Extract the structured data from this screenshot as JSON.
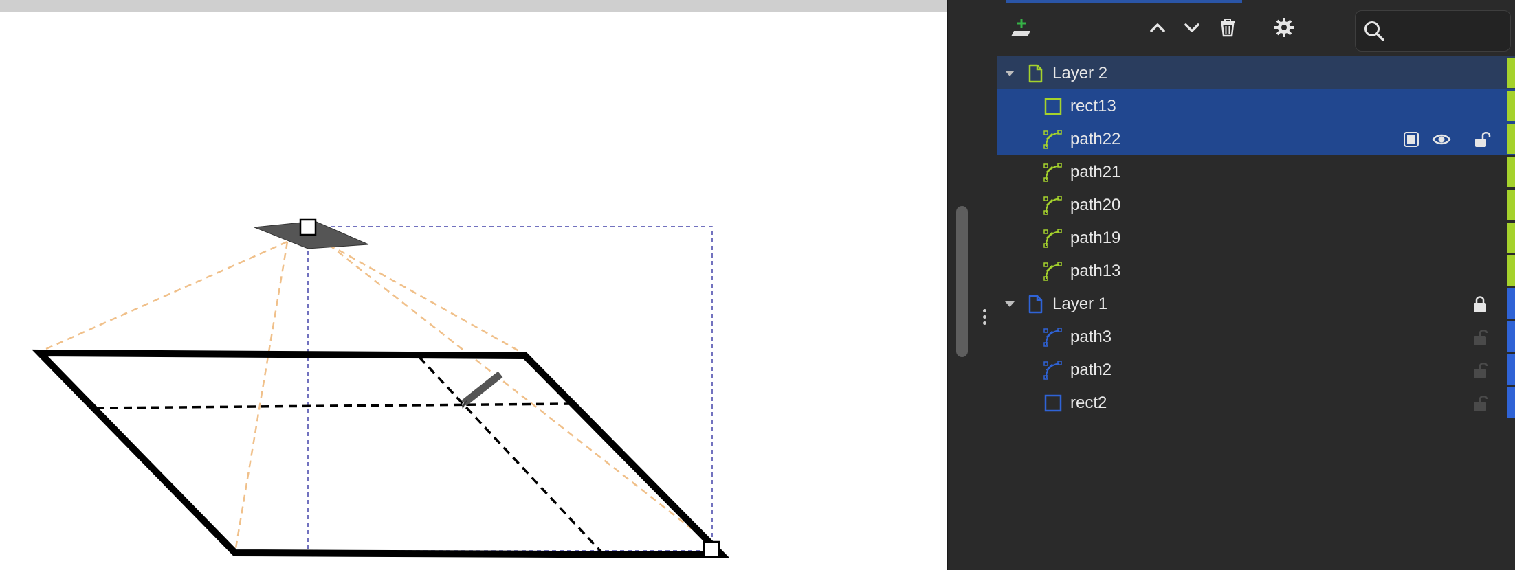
{
  "app": {
    "colors": {
      "layer2": "#a5d22c",
      "layer1": "#2f63d6",
      "selection": "#21478f",
      "selection_parent": "#2a3d5e",
      "add_layer": "#35b246",
      "guide_dashed": "#f0c08a",
      "bbox_dashed": "#4444aa"
    }
  },
  "toolbar": {
    "add_layer_icon": "add-layer-icon",
    "raise_icon": "chevron-up-icon",
    "lower_icon": "chevron-down-icon",
    "delete_icon": "trash-icon",
    "settings_icon": "gear-icon",
    "search_icon": "search-icon",
    "search_value": ""
  },
  "layers": {
    "layer2": {
      "label": "Layer 2",
      "children": [
        {
          "label": "rect13",
          "type": "rect"
        },
        {
          "label": "path22",
          "type": "path"
        },
        {
          "label": "path21",
          "type": "path"
        },
        {
          "label": "path20",
          "type": "path"
        },
        {
          "label": "path19",
          "type": "path"
        },
        {
          "label": "path13",
          "type": "path"
        }
      ]
    },
    "layer1": {
      "label": "Layer 1",
      "locked": true,
      "children": [
        {
          "label": "path3",
          "type": "path"
        },
        {
          "label": "path2",
          "type": "path"
        },
        {
          "label": "rect2",
          "type": "rect"
        }
      ]
    }
  }
}
